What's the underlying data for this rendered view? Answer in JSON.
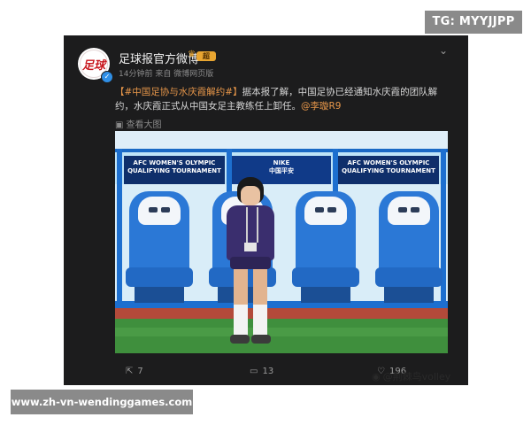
{
  "watermarks": {
    "top_right": "TG: MYYJJPP",
    "bottom_left": "www.zh-vn-wendinggames.com",
    "bottom_right": "@荆棘鸟volley"
  },
  "post": {
    "account_name": "足球报官方微博",
    "account_badge": "超",
    "timestamp": "14分钟前",
    "source": "来自 微博网页版",
    "hashtag": "【#中国足协与水庆霞解约#】",
    "body_line1": "据本报了解，中国足协已经通知水庆霞的团队解",
    "body_line2": "约，水庆霞正式从中国女足主教练任上卸任。",
    "mention": "@李璇R9",
    "view_big_image": "查看大图",
    "avatar_mark": "足球",
    "photo": {
      "banner_left": [
        "AFC WOMEN'S OLYMPIC",
        "QUALIFYING TOURNAMENT"
      ],
      "banner_center": [
        "NIKE",
        "中国平安"
      ],
      "banner_right": [
        "AFC WOMEN'S OLYMPIC",
        "QUALIFYING TOURNAMENT"
      ]
    },
    "actions": {
      "repost_count": "7",
      "comment_count": "13",
      "like_count": "196"
    }
  },
  "icons": {
    "more": "chevron-down-icon",
    "view_image": "image-icon",
    "repost": "repost-icon",
    "comment": "comment-icon",
    "like": "like-icon",
    "verified": "verified-icon",
    "crown": "crown-icon"
  },
  "colors": {
    "card_bg": "#1c1c1d",
    "link_orange": "#e8974a",
    "meta_gray": "#8a8a8a"
  }
}
